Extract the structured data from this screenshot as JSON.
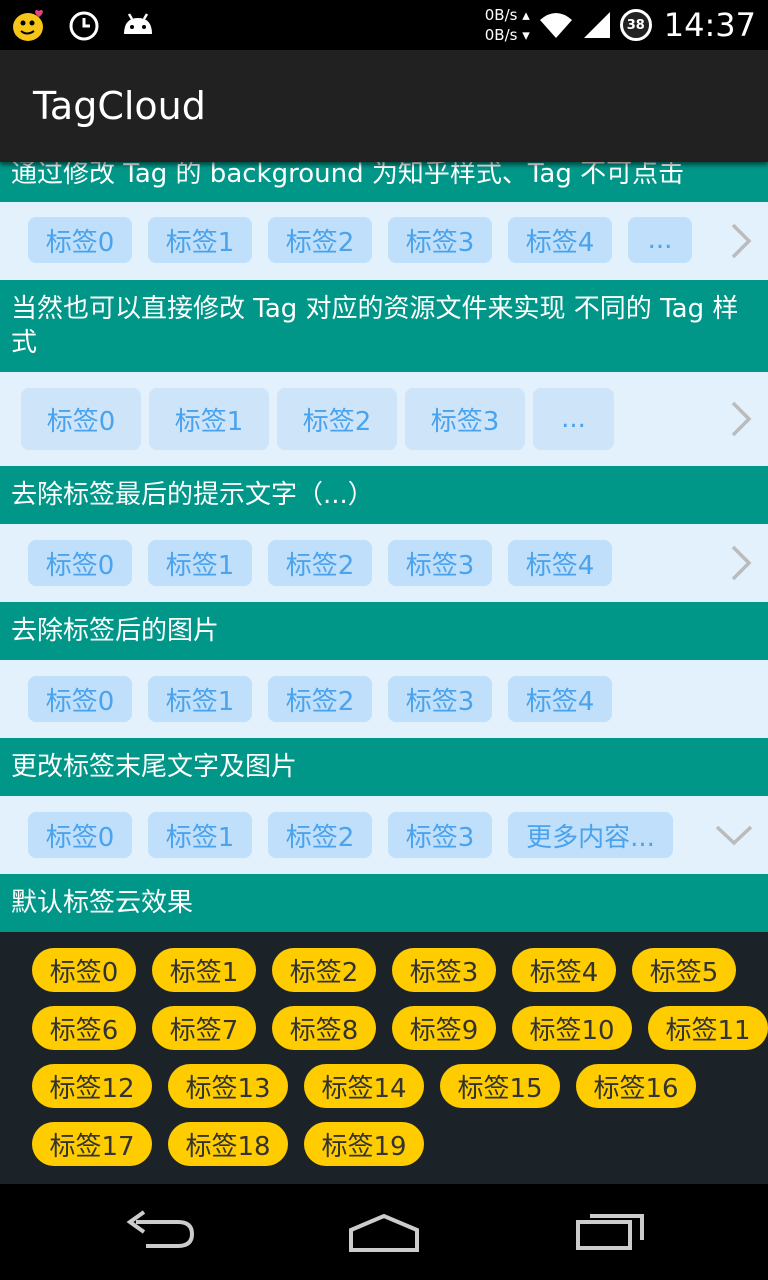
{
  "status_bar": {
    "net_up": "0B/s",
    "net_down": "0B/s",
    "battery": "38",
    "time": "14:37"
  },
  "app": {
    "title": "TagCloud"
  },
  "sections": [
    {
      "header": "通过修改 Tag 的 background 为知乎样式、Tag 不可点击",
      "tags": [
        "标签0",
        "标签1",
        "标签2",
        "标签3",
        "标签4",
        "..."
      ],
      "indicator": "chevron-right-icon"
    },
    {
      "header": "当然也可以直接修改 Tag 对应的资源文件来实现 不同的 Tag 样式",
      "tags": [
        "标签0",
        "标签1",
        "标签2",
        "标签3",
        "..."
      ],
      "indicator": "chevron-right-icon"
    },
    {
      "header": "去除标签最后的提示文字（...）",
      "tags": [
        "标签0",
        "标签1",
        "标签2",
        "标签3",
        "标签4"
      ],
      "indicator": "chevron-right-icon"
    },
    {
      "header": "去除标签后的图片",
      "tags": [
        "标签0",
        "标签1",
        "标签2",
        "标签3",
        "标签4"
      ]
    },
    {
      "header": "更改标签末尾文字及图片",
      "tags": [
        "标签0",
        "标签1",
        "标签2",
        "标签3",
        "更多内容..."
      ],
      "indicator": "chevron-down-icon"
    },
    {
      "header": "默认标签云效果",
      "tags": [
        "标签0",
        "标签1",
        "标签2",
        "标签3",
        "标签4",
        "标签5",
        "标签6",
        "标签7",
        "标签8",
        "标签9",
        "标签10",
        "标签11",
        "标签12",
        "标签13",
        "标签14",
        "标签15",
        "标签16",
        "标签17",
        "标签18",
        "标签19"
      ]
    }
  ],
  "colors": {
    "header_bg": "#009688",
    "tag_bg": "#bfdffa",
    "tag_text": "#4aa3ec",
    "cloud_bg": "#1c2328",
    "cloud_tag_bg": "#ffcc00"
  }
}
